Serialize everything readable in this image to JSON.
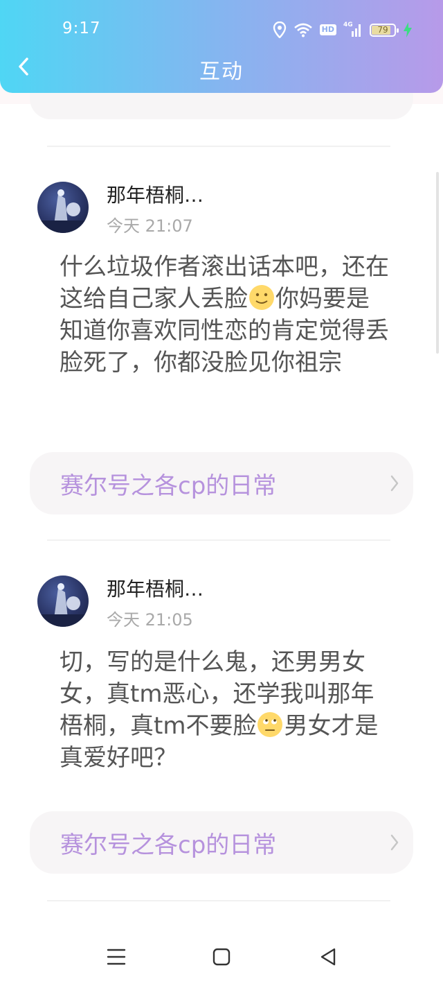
{
  "status_bar": {
    "time": "9:17",
    "battery": "79",
    "hd": "HD",
    "net": "4G"
  },
  "header": {
    "title": "互动"
  },
  "comments": [
    {
      "username": "那年梧桐…",
      "time": "今天 21:07",
      "content_before": "什么垃圾作者滚出话本吧，还在这给自己家人丢脸",
      "emoji": "slightly-smiling-face",
      "content_after": "你妈要是知道你喜欢同性恋的肯定觉得丢脸死了，你都没脸见你祖宗",
      "link": "赛尔号之各cp的日常"
    },
    {
      "username": "那年梧桐…",
      "time": "今天 21:05",
      "content_before": "切，写的是什么鬼，还男男女女，真tm恶心，还学我叫那年梧桐，真tm不要脸",
      "emoji": "eye-roll-face",
      "content_after": "男女才是真爱好吧？",
      "link": "赛尔号之各cp的日常"
    }
  ],
  "colors": {
    "header_gradient_start": "#4fd6f4",
    "header_gradient_end": "#b79ae9",
    "link_text": "#b692dd",
    "card_bg": "#f7f5f6"
  }
}
